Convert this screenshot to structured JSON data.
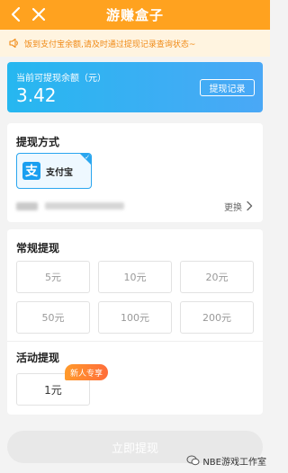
{
  "header": {
    "title": "游赚盒子",
    "back_icon": "chevron-left-icon",
    "close_icon": "close-icon",
    "background": "#ffa21f"
  },
  "notice": {
    "icon": "speaker-icon",
    "text": "饭到支付宝余额,请及时通过提现记录查询状态~",
    "color": "#f08a16"
  },
  "balance": {
    "label": "当前可提现余额（元）",
    "amount": "3.42",
    "record_button": "提现记录"
  },
  "withdraw_method": {
    "title": "提现方式",
    "selected_method": "支付宝",
    "change_label": "更换"
  },
  "regular_withdraw": {
    "title": "常规提现",
    "options": [
      "5元",
      "10元",
      "20元",
      "50元",
      "100元",
      "200元"
    ]
  },
  "activity_withdraw": {
    "title": "活动提现",
    "option": "1元",
    "badge": "新人专享"
  },
  "submit_label": "立即提现",
  "watermark": "NBE游戏工作室"
}
